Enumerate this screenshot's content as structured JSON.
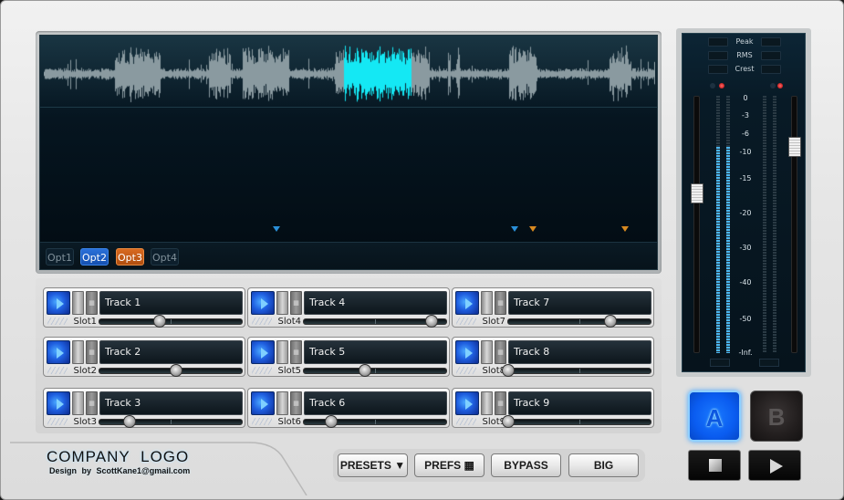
{
  "display": {
    "options": [
      {
        "label": "Opt1",
        "state": "off"
      },
      {
        "label": "Opt2",
        "state": "blue"
      },
      {
        "label": "Opt3",
        "state": "orange"
      },
      {
        "label": "Opt4",
        "state": "off"
      }
    ],
    "markers": [
      {
        "color": "blue",
        "position": 0.38
      },
      {
        "color": "blue",
        "position": 0.77
      },
      {
        "color": "orange",
        "position": 0.8
      },
      {
        "color": "orange",
        "position": 0.95
      }
    ],
    "waveform_highlight_range": [
      0.49,
      0.6
    ],
    "colors": {
      "waveform": "#8a9aa0",
      "highlight": "#14e8f4"
    }
  },
  "tracks": [
    {
      "name": "Track 1",
      "slot": "Slot1",
      "level": 0.42
    },
    {
      "name": "Track 2",
      "slot": "Slot2",
      "level": 0.54
    },
    {
      "name": "Track 3",
      "slot": "Slot3",
      "level": 0.21
    },
    {
      "name": "Track 4",
      "slot": "Slot4",
      "level": 0.9
    },
    {
      "name": "Track 5",
      "slot": "Slot5",
      "level": 0.43
    },
    {
      "name": "Track 6",
      "slot": "Slot6",
      "level": 0.19
    },
    {
      "name": "Track 7",
      "slot": "Slot7",
      "level": 0.72
    },
    {
      "name": "Track 8",
      "slot": "Slot8",
      "level": 0.0
    },
    {
      "name": "Track 9",
      "slot": "Slot9",
      "level": 0.0
    }
  ],
  "meter": {
    "stats": [
      "Peak",
      "RMS",
      "Crest"
    ],
    "scale": [
      "0",
      "-3",
      "-6",
      "-10",
      "-15",
      "-20",
      "-30",
      "-40",
      "-50",
      "-Inf."
    ],
    "left_fader": 0.62,
    "right_fader": 0.8,
    "left_level": 0.8,
    "right_level": 0.0
  },
  "footer": {
    "logo_title": "COMPANY LOGO",
    "logo_sub": "Design by ScottKane1@gmail.com",
    "buttons": {
      "presets": "PRESETS ▼",
      "prefs": "PREFS ▦",
      "bypass": "BYPASS",
      "big": "BIG"
    }
  },
  "ab": {
    "a": "A",
    "b": "B",
    "active": "A"
  },
  "transport": {
    "stop": "stop-icon",
    "play": "play-icon"
  }
}
